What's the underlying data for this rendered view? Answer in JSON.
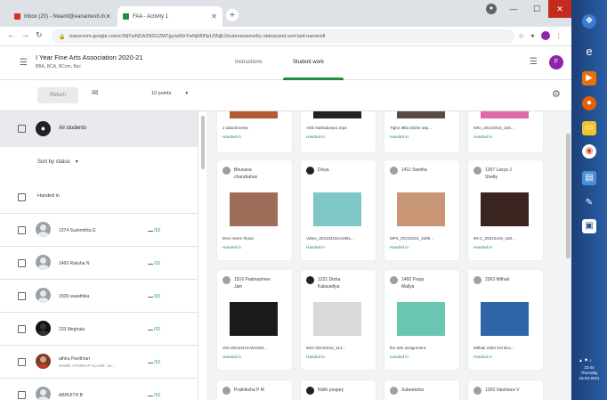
{
  "browser": {
    "tabs": [
      {
        "label": "Inbox (20) - Nwanti@eanamesh.in",
        "favicon_color": "#d93025"
      },
      {
        "label": "FAA - Activity 1",
        "favicon_color": "#1e8e3e"
      }
    ],
    "url": "classroom.google.com/c/MjYwNDA2NDU2MTgy/a/MzYwNjM0NzU0NjE2/submissions/by-status/and-sort-last-name/all"
  },
  "header": {
    "class_title": "I Year Fine Arts Association 2020-21",
    "class_subtitle": "BBA, BCA, BCom, Bsc",
    "tabs": [
      {
        "label": "Instructions"
      },
      {
        "label": "Student work"
      }
    ],
    "avatar_letter": "F"
  },
  "toolbar": {
    "return_label": "Return",
    "points_label": "10 points",
    "points_caret": "▾"
  },
  "sidebar": {
    "all_students_label": "All students",
    "sort_label": "Sort by status",
    "sort_caret": "▾",
    "handed_in_label": "Handed in",
    "students": [
      {
        "name": "1374 Sushmitha.G",
        "grade": "/10",
        "avatar": "default"
      },
      {
        "name": "1460 Raksha N",
        "grade": "/10",
        "avatar": "default"
      },
      {
        "name": "1509 swasthika",
        "grade": "/10",
        "avatar": "default"
      },
      {
        "name": "233 Meghala",
        "grade": "/10",
        "avatar": "dark"
      },
      {
        "name": "athira Pavithran",
        "sub": "NAME: ATHIRA P CLASS: 1S...",
        "grade": "/10",
        "avatar": "photo"
      },
      {
        "name": "ABHIJITH B",
        "grade": "/10",
        "avatar": "default"
      }
    ]
  },
  "cards_row1": [
    {
      "file": "2 attachments",
      "status": "Handed in"
    },
    {
      "file": "Abhi Nathabeep1.mp4",
      "status": "Handed in"
    },
    {
      "file": "Tighe Mba Dishe asp...",
      "status": "Handed in"
    },
    {
      "file": "IMG_20210415_225...",
      "status": "Handed in"
    }
  ],
  "cards_row2": [
    {
      "name1": "Bhuvana",
      "name2": "chandrahas",
      "file": "Devi neere thutai",
      "status": "Handed in",
      "thumb": "#9e6e5a"
    },
    {
      "name1": "Divya",
      "name2": "",
      "file": "Video_20210415141901...",
      "status": "Handed in",
      "thumb": "#7fc6c9"
    },
    {
      "name1": "1411 Swetha",
      "name2": "",
      "file": "MP4_20210415_1608...",
      "status": "Handed in",
      "thumb": "#c89575"
    },
    {
      "name1": "1307 Laxya J",
      "name2": "Shetty",
      "file": "IM-C_20210415_160...",
      "status": "Handed in",
      "thumb": "#3a2420"
    }
  ],
  "cards_row3": [
    {
      "name1": "1516 Padmashree",
      "name2": "Jain",
      "file": "VID-20210415-WA003...",
      "status": "Handed in",
      "thumb": "#1a1a1a"
    },
    {
      "name1": "1221 Disha",
      "name2": "Kalavadiya",
      "file": "IMG-20210415_112...",
      "status": "Handed in",
      "thumb": "#d9d9d9"
    },
    {
      "name1": "1460 Pooja",
      "name2": "Mallya",
      "file": "the arts assignment",
      "status": "Handed in",
      "thumb": "#69c6b0"
    },
    {
      "name1": "2363 Mithali",
      "name2": "",
      "file": "Mithali 2363 3rd Bco...",
      "status": "Handed in",
      "thumb": "#2e64a8"
    }
  ],
  "cards_row4": [
    {
      "name1": "Prathiksha P M"
    },
    {
      "name1": "Nidhi poojary"
    },
    {
      "name1": "Subeeksha"
    },
    {
      "name1": "1320 Vaishnavi V"
    }
  ],
  "taskbar": {
    "clock_time": "23:44",
    "clock_day": "Thursday",
    "clock_date": "15-04-2021"
  }
}
